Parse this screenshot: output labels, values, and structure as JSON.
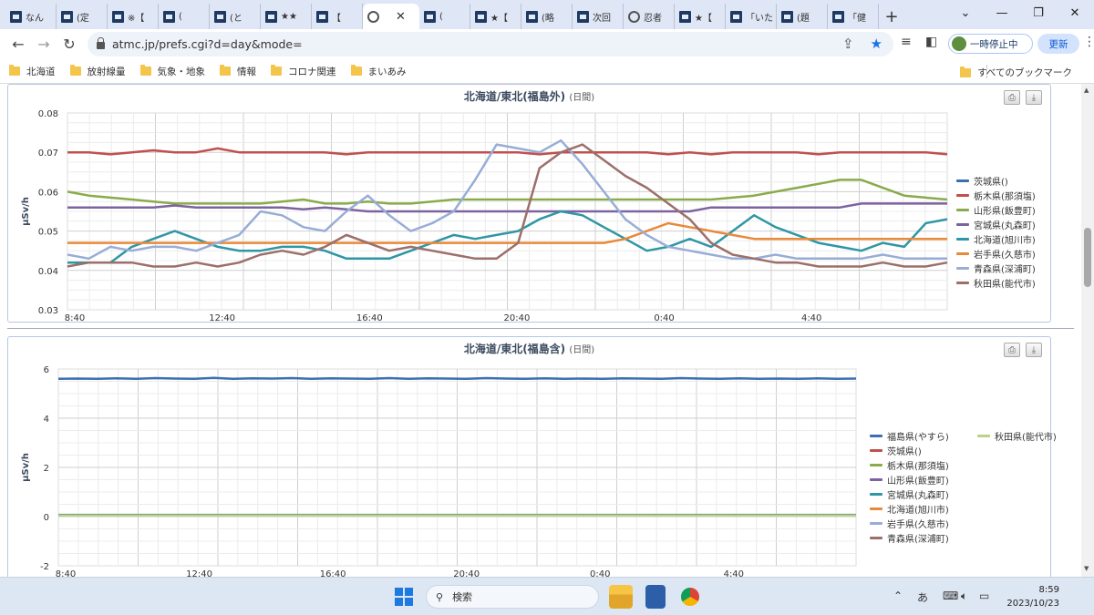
{
  "browser": {
    "tabs": [
      {
        "label": "なん",
        "icon": "site-favicon-icon"
      },
      {
        "label": "(定",
        "icon": "site-favicon-icon"
      },
      {
        "label": "※【",
        "icon": "site-favicon-icon"
      },
      {
        "label": "(",
        "icon": "site-favicon-icon"
      },
      {
        "label": "(と",
        "icon": "site-favicon-icon"
      },
      {
        "label": "★★",
        "icon": "site-favicon-icon"
      },
      {
        "label": "【",
        "icon": "site-favicon-icon"
      },
      {
        "label": "",
        "icon": "globe-icon",
        "active": true
      },
      {
        "label": "(",
        "icon": "site-favicon-icon"
      },
      {
        "label": "★【",
        "icon": "site-favicon-icon"
      },
      {
        "label": "(略",
        "icon": "site-favicon-icon"
      },
      {
        "label": "次回",
        "icon": "site-favicon-icon"
      },
      {
        "label": "忍者",
        "icon": "globe-icon"
      },
      {
        "label": "★【",
        "icon": "site-favicon-icon"
      },
      {
        "label": "「いた",
        "icon": "site-favicon-icon"
      },
      {
        "label": "(題",
        "icon": "site-favicon-icon"
      },
      {
        "label": "「健",
        "icon": "site-favicon-icon"
      }
    ],
    "new_tab": "+",
    "url": "atmc.jp/prefs.cgi?d=day&mode=",
    "pause_label": "一時停止中",
    "update_label": "更新",
    "bookmarks": [
      "北海道",
      "放射線量",
      "気象・地象",
      "情報",
      "コロナ関連",
      "まいあみ"
    ],
    "all_bookmarks": "すべてのブックマーク"
  },
  "charts": {
    "top": {
      "title": "北海道/東北(福島外)",
      "subtitle": "(日間)",
      "ylabel": "μSv/h"
    },
    "bottom": {
      "title": "北海道/東北(福島含)",
      "subtitle": "(日間)",
      "ylabel": "μSv/h"
    }
  },
  "chart_data": [
    {
      "type": "line",
      "title": "北海道/東北(福島外)",
      "subtitle": "(日間)",
      "ylabel": "μSv/h",
      "ylim": [
        0.03,
        0.08
      ],
      "yticks": [
        "0.08",
        "0.07",
        "0.06",
        "0.05",
        "0.04",
        "0.03"
      ],
      "xlabels": [
        "8:40",
        "12:40",
        "16:40",
        "20:40",
        "0:40",
        "4:40"
      ],
      "grid": true,
      "legend": "right",
      "series": [
        {
          "name": "茨城県()",
          "color": "#3b6fb0",
          "values": []
        },
        {
          "name": "栃木県(那須塩)",
          "color": "#c0504d",
          "values": [
            0.07,
            0.07,
            0.0695,
            0.07,
            0.0705,
            0.07,
            0.07,
            0.071,
            0.07,
            0.07,
            0.07,
            0.07,
            0.07,
            0.0695,
            0.07,
            0.07,
            0.07,
            0.07,
            0.07,
            0.07,
            0.07,
            0.07,
            0.0695,
            0.07,
            0.07,
            0.07,
            0.07,
            0.07,
            0.0695,
            0.07,
            0.0695,
            0.07,
            0.07,
            0.07,
            0.07,
            0.0695,
            0.07,
            0.07,
            0.07,
            0.07,
            0.07,
            0.0695
          ]
        },
        {
          "name": "山形県(飯豊町)",
          "color": "#8aab4b",
          "values": [
            0.06,
            0.059,
            0.0585,
            0.058,
            0.0575,
            0.057,
            0.057,
            0.057,
            0.057,
            0.057,
            0.0575,
            0.058,
            0.057,
            0.057,
            0.0575,
            0.057,
            0.057,
            0.0575,
            0.058,
            0.058,
            0.058,
            0.058,
            0.058,
            0.058,
            0.058,
            0.058,
            0.058,
            0.058,
            0.058,
            0.058,
            0.058,
            0.0585,
            0.059,
            0.06,
            0.061,
            0.062,
            0.063,
            0.063,
            0.061,
            0.059,
            0.0585,
            0.058
          ]
        },
        {
          "name": "宮城県(丸森町)",
          "color": "#7d62a0",
          "values": [
            0.056,
            0.056,
            0.056,
            0.056,
            0.056,
            0.0565,
            0.056,
            0.056,
            0.056,
            0.056,
            0.056,
            0.0555,
            0.056,
            0.0555,
            0.055,
            0.055,
            0.055,
            0.055,
            0.055,
            0.055,
            0.055,
            0.055,
            0.055,
            0.055,
            0.055,
            0.055,
            0.055,
            0.055,
            0.055,
            0.055,
            0.056,
            0.056,
            0.056,
            0.056,
            0.056,
            0.056,
            0.056,
            0.057,
            0.057,
            0.057,
            0.057,
            0.057
          ]
        },
        {
          "name": "北海道(旭川市)",
          "color": "#2f96a6",
          "values": [
            0.042,
            0.042,
            0.042,
            0.046,
            0.048,
            0.05,
            0.048,
            0.046,
            0.045,
            0.045,
            0.046,
            0.046,
            0.045,
            0.043,
            0.043,
            0.043,
            0.045,
            0.047,
            0.049,
            0.048,
            0.049,
            0.05,
            0.053,
            0.055,
            0.054,
            0.051,
            0.048,
            0.045,
            0.046,
            0.048,
            0.046,
            0.05,
            0.054,
            0.051,
            0.049,
            0.047,
            0.046,
            0.045,
            0.047,
            0.046,
            0.052,
            0.053
          ]
        },
        {
          "name": "岩手県(久慈市)",
          "color": "#e8893a",
          "values": [
            0.047,
            0.047,
            0.047,
            0.047,
            0.047,
            0.047,
            0.047,
            0.047,
            0.047,
            0.047,
            0.047,
            0.047,
            0.047,
            0.047,
            0.047,
            0.047,
            0.047,
            0.047,
            0.047,
            0.047,
            0.047,
            0.047,
            0.047,
            0.047,
            0.047,
            0.047,
            0.048,
            0.05,
            0.052,
            0.051,
            0.05,
            0.049,
            0.048,
            0.048,
            0.048,
            0.048,
            0.048,
            0.048,
            0.048,
            0.048,
            0.048,
            0.048
          ]
        },
        {
          "name": "青森県(深浦町)",
          "color": "#98add6",
          "values": [
            0.044,
            0.043,
            0.046,
            0.045,
            0.046,
            0.046,
            0.045,
            0.047,
            0.049,
            0.055,
            0.054,
            0.051,
            0.05,
            0.055,
            0.059,
            0.054,
            0.05,
            0.052,
            0.055,
            0.063,
            0.072,
            0.071,
            0.07,
            0.073,
            0.067,
            0.06,
            0.053,
            0.049,
            0.046,
            0.045,
            0.044,
            0.043,
            0.043,
            0.044,
            0.043,
            0.043,
            0.043,
            0.043,
            0.044,
            0.043,
            0.043,
            0.043
          ]
        },
        {
          "name": "秋田県(能代市)",
          "color": "#9c6f6a",
          "values": [
            0.041,
            0.042,
            0.042,
            0.042,
            0.041,
            0.041,
            0.042,
            0.041,
            0.042,
            0.044,
            0.045,
            0.044,
            0.046,
            0.049,
            0.047,
            0.045,
            0.046,
            0.045,
            0.044,
            0.043,
            0.043,
            0.047,
            0.066,
            0.07,
            0.072,
            0.068,
            0.064,
            0.061,
            0.057,
            0.053,
            0.047,
            0.044,
            0.043,
            0.042,
            0.042,
            0.041,
            0.041,
            0.041,
            0.042,
            0.041,
            0.041,
            0.042
          ]
        }
      ]
    },
    {
      "type": "line",
      "title": "北海道/東北(福島含)",
      "subtitle": "(日間)",
      "ylabel": "μSv/h",
      "ylim": [
        -2,
        6
      ],
      "yticks": [
        "6",
        "4",
        "2",
        "0",
        "-2"
      ],
      "xlabels": [
        "8:40",
        "12:40",
        "16:40",
        "20:40",
        "0:40",
        "4:40"
      ],
      "grid": true,
      "legend": "right",
      "series": [
        {
          "name": "福島県(やすら)",
          "color": "#3b6fb0",
          "values": [
            5.6,
            5.61,
            5.6,
            5.62,
            5.6,
            5.63,
            5.61,
            5.6,
            5.64,
            5.6,
            5.62,
            5.61,
            5.63,
            5.6,
            5.62,
            5.61,
            5.6,
            5.63,
            5.6,
            5.62,
            5.61,
            5.6,
            5.63,
            5.61,
            5.6,
            5.62,
            5.6,
            5.61,
            5.6,
            5.62,
            5.61,
            5.6,
            5.63,
            5.61,
            5.6,
            5.62,
            5.6,
            5.61,
            5.6,
            5.62,
            5.6,
            5.61
          ]
        },
        {
          "name": "茨城県()",
          "color": "#c0504d",
          "values": []
        },
        {
          "name": "栃木県(那須塩)",
          "color": "#8aab4b",
          "values": [
            0.07,
            0.07,
            0.07,
            0.07,
            0.07,
            0.07,
            0.07,
            0.07,
            0.07,
            0.07,
            0.07,
            0.07,
            0.07,
            0.07,
            0.07,
            0.07,
            0.07,
            0.07,
            0.07,
            0.07,
            0.07,
            0.07,
            0.07,
            0.07,
            0.07,
            0.07,
            0.07,
            0.07,
            0.07,
            0.07,
            0.07,
            0.07,
            0.07,
            0.07,
            0.07,
            0.07,
            0.07,
            0.07,
            0.07,
            0.07,
            0.07,
            0.07
          ]
        },
        {
          "name": "山形県(飯豊町)",
          "color": "#7d62a0",
          "values": [
            0.06,
            0.06,
            0.06,
            0.06,
            0.06,
            0.06,
            0.06,
            0.06,
            0.06,
            0.06,
            0.06,
            0.06,
            0.06,
            0.06,
            0.06,
            0.06,
            0.06,
            0.06,
            0.06,
            0.06,
            0.06,
            0.06,
            0.06,
            0.06,
            0.06,
            0.06,
            0.06,
            0.06,
            0.06,
            0.06,
            0.06,
            0.06,
            0.06,
            0.06,
            0.06,
            0.06,
            0.06,
            0.06,
            0.06,
            0.06,
            0.06,
            0.06
          ]
        },
        {
          "name": "宮城県(丸森町)",
          "color": "#2f96a6",
          "values": [
            0.056,
            0.056,
            0.056,
            0.056,
            0.056,
            0.056,
            0.056,
            0.056,
            0.056,
            0.056,
            0.056,
            0.056,
            0.056,
            0.056,
            0.056,
            0.056,
            0.056,
            0.056,
            0.056,
            0.056,
            0.056,
            0.056,
            0.056,
            0.056,
            0.056,
            0.056,
            0.056,
            0.056,
            0.056,
            0.056,
            0.056,
            0.056,
            0.056,
            0.056,
            0.056,
            0.056,
            0.056,
            0.056,
            0.056,
            0.056,
            0.056,
            0.056
          ]
        },
        {
          "name": "北海道(旭川市)",
          "color": "#e8893a",
          "values": [
            0.045,
            0.045,
            0.045,
            0.045,
            0.045,
            0.045,
            0.045,
            0.045,
            0.045,
            0.045,
            0.045,
            0.045,
            0.045,
            0.045,
            0.045,
            0.045,
            0.045,
            0.045,
            0.045,
            0.045,
            0.045,
            0.045,
            0.045,
            0.045,
            0.045,
            0.045,
            0.045,
            0.045,
            0.045,
            0.045,
            0.045,
            0.045,
            0.045,
            0.045,
            0.045,
            0.045,
            0.045,
            0.045,
            0.045,
            0.045,
            0.045,
            0.045
          ]
        },
        {
          "name": "岩手県(久慈市)",
          "color": "#98add6",
          "values": [
            0.047,
            0.047,
            0.047,
            0.047,
            0.047,
            0.047,
            0.047,
            0.047,
            0.047,
            0.047,
            0.047,
            0.047,
            0.047,
            0.047,
            0.047,
            0.047,
            0.047,
            0.047,
            0.047,
            0.047,
            0.047,
            0.047,
            0.047,
            0.047,
            0.047,
            0.047,
            0.047,
            0.047,
            0.047,
            0.047,
            0.047,
            0.047,
            0.047,
            0.047,
            0.047,
            0.047,
            0.047,
            0.047,
            0.047,
            0.047,
            0.047,
            0.047
          ]
        },
        {
          "name": "青森県(深浦町)",
          "color": "#9c6f6a",
          "values": [
            0.044,
            0.044,
            0.044,
            0.044,
            0.044,
            0.044,
            0.044,
            0.044,
            0.044,
            0.044,
            0.044,
            0.044,
            0.044,
            0.044,
            0.044,
            0.044,
            0.044,
            0.044,
            0.044,
            0.044,
            0.044,
            0.044,
            0.044,
            0.044,
            0.044,
            0.044,
            0.044,
            0.044,
            0.044,
            0.044,
            0.044,
            0.044,
            0.044,
            0.044,
            0.044,
            0.044,
            0.044,
            0.044,
            0.044,
            0.044,
            0.044,
            0.044
          ]
        },
        {
          "name": "秋田県(能代市)",
          "color": "#b7d48a",
          "values": [
            0.042,
            0.042,
            0.042,
            0.042,
            0.042,
            0.042,
            0.042,
            0.042,
            0.042,
            0.042,
            0.042,
            0.042,
            0.042,
            0.042,
            0.042,
            0.042,
            0.042,
            0.042,
            0.042,
            0.042,
            0.042,
            0.042,
            0.042,
            0.042,
            0.042,
            0.042,
            0.042,
            0.042,
            0.042,
            0.042,
            0.042,
            0.042,
            0.042,
            0.042,
            0.042,
            0.042,
            0.042,
            0.042,
            0.042,
            0.042,
            0.042,
            0.042
          ]
        }
      ]
    }
  ],
  "taskbar": {
    "search_placeholder": "検索",
    "ime": "あ",
    "time": "8:59",
    "date": "2023/10/23"
  }
}
